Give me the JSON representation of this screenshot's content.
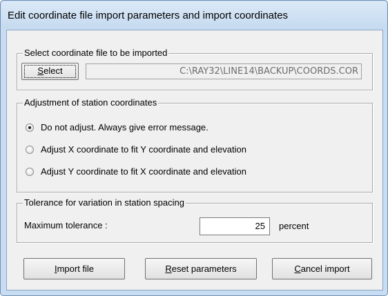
{
  "window": {
    "title": "Edit coordinate file import parameters and import coordinates"
  },
  "file_group": {
    "legend": "Select coordinate file to be imported",
    "select_button": {
      "accel": "S",
      "rest": "elect"
    },
    "file_path": "C:\\RAY32\\LINE14\\BACKUP\\COORDS.COR"
  },
  "adjust_group": {
    "legend": "Adjustment of station coordinates",
    "options": [
      {
        "label": "Do not adjust. Always give error message.",
        "checked": true
      },
      {
        "label": "Adjust X coordinate to fit Y coordinate and elevation",
        "checked": false
      },
      {
        "label": "Adjust Y coordinate to fit X coordinate and elevation",
        "checked": false
      }
    ]
  },
  "tolerance_group": {
    "legend": "Tolerance for variation in station spacing",
    "label": "Maximum tolerance :",
    "value": "25",
    "unit": "percent"
  },
  "buttons": {
    "import": {
      "accel": "I",
      "rest": "mport file"
    },
    "reset": {
      "accel": "R",
      "rest": "eset parameters"
    },
    "cancel": {
      "accel": "C",
      "rest": "ancel import"
    }
  }
}
